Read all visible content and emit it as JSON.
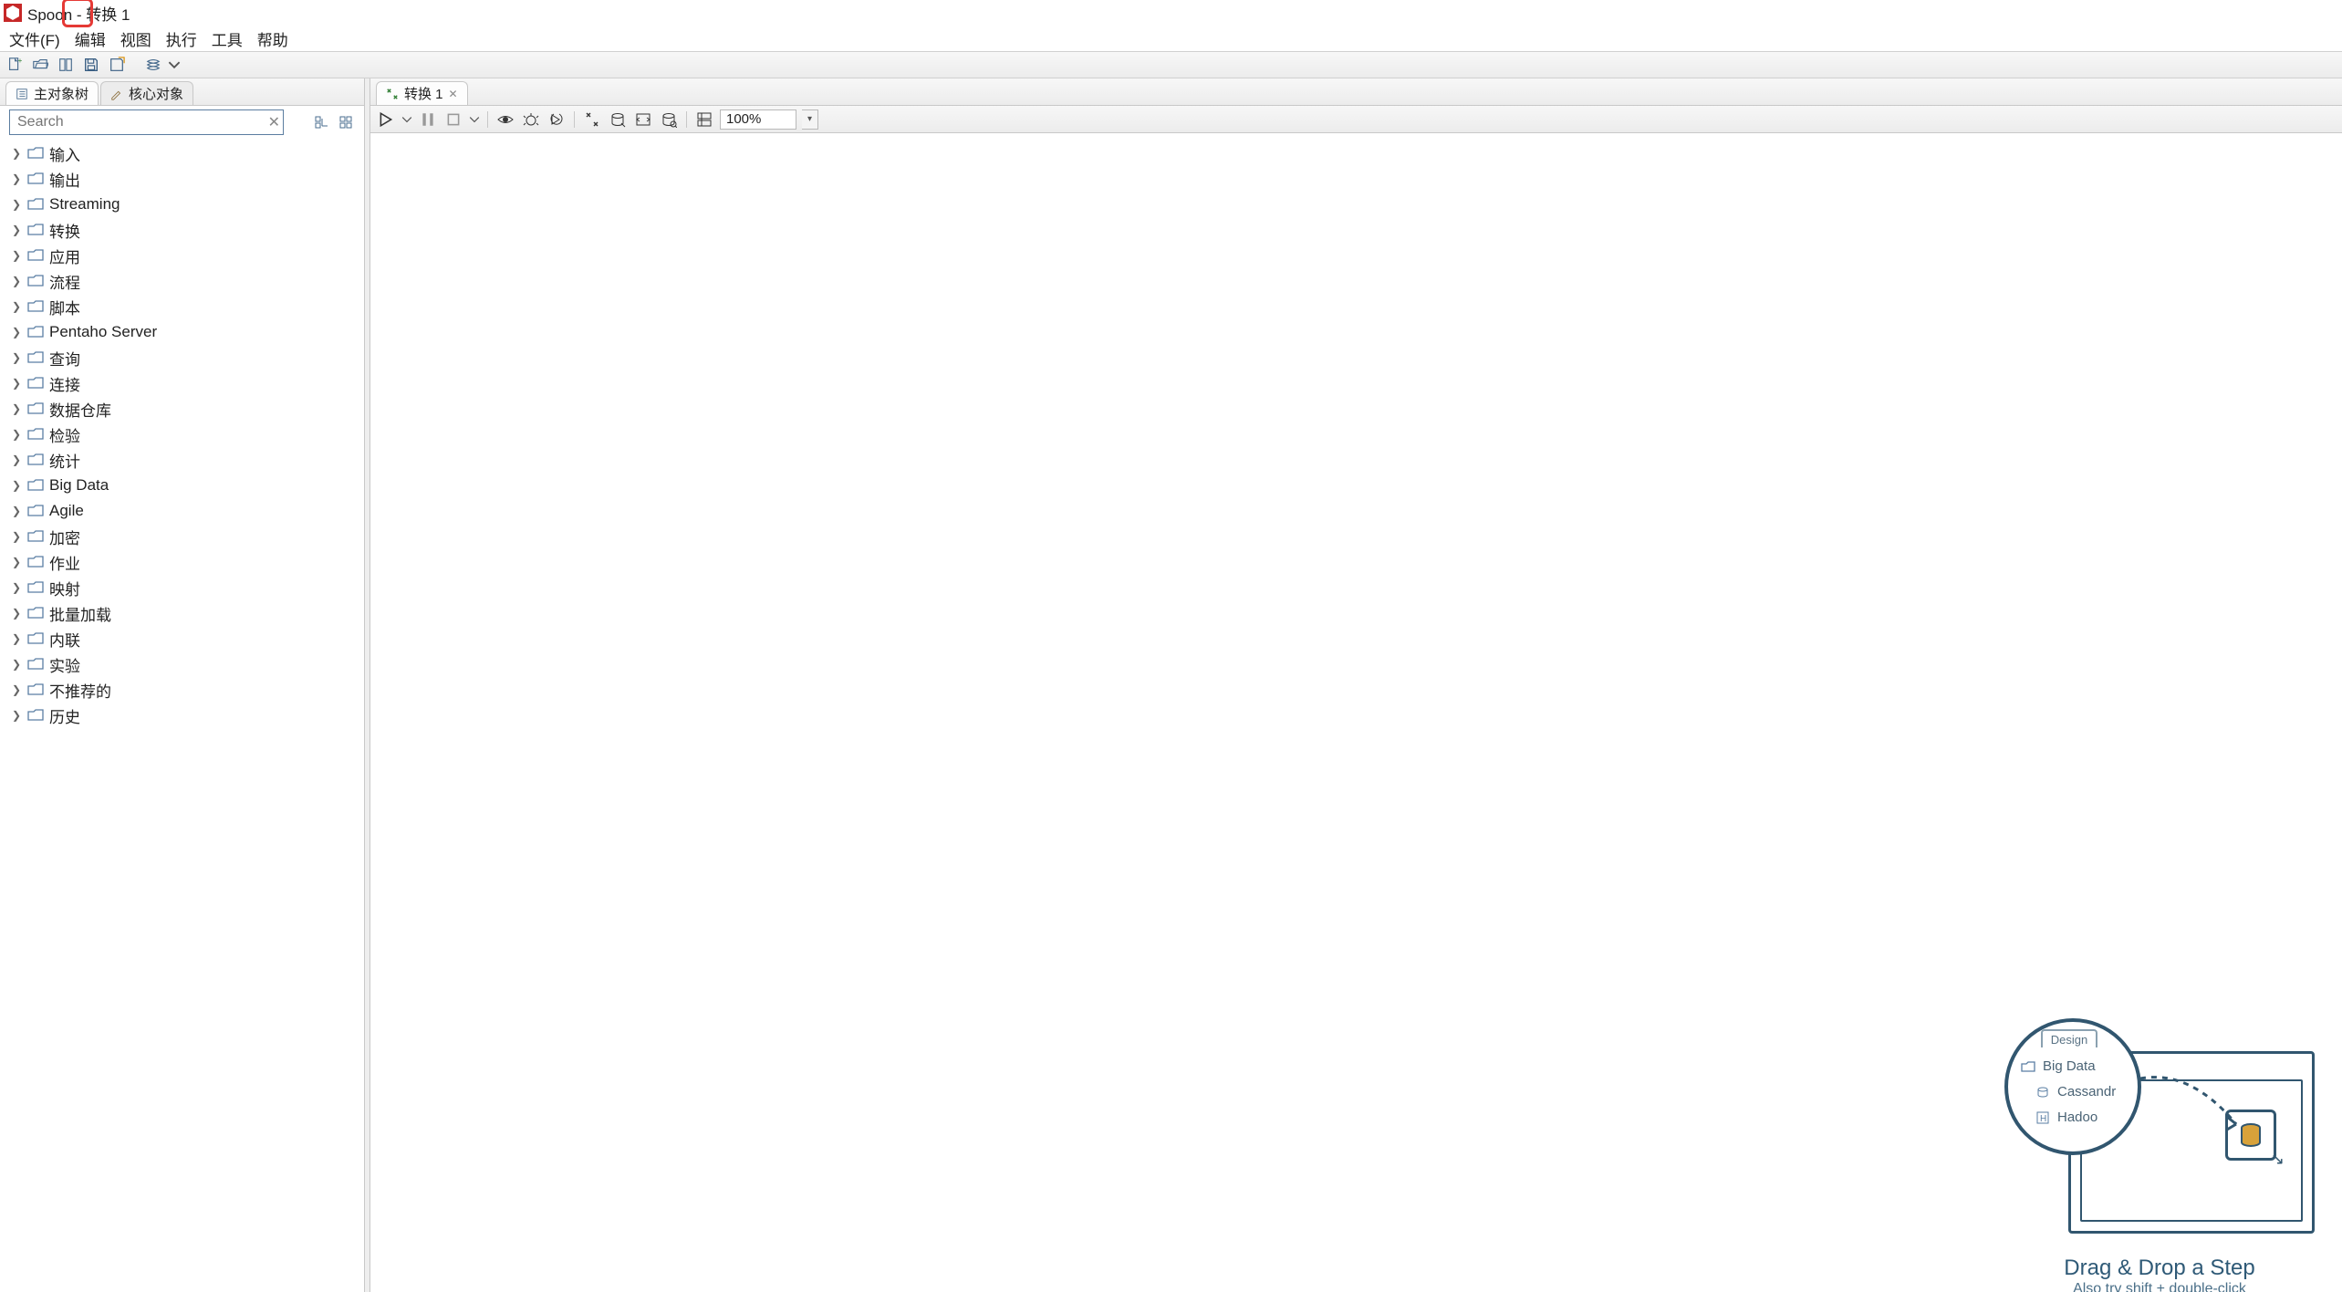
{
  "window": {
    "title": "Spoon - 转换 1"
  },
  "menu": {
    "items": [
      "文件(F)",
      "编辑",
      "视图",
      "执行",
      "工具",
      "帮助"
    ]
  },
  "toolbar": {
    "items": [
      "new-file",
      "open-file",
      "explore-repo",
      "save",
      "save-as",
      "layers",
      "layers-dropdown"
    ]
  },
  "left": {
    "tabs": [
      {
        "id": "main-tree",
        "label": "主对象树",
        "icon": "tree-icon"
      },
      {
        "id": "core-objects",
        "label": "核心对象",
        "icon": "pencil-icon"
      }
    ],
    "search_placeholder": "Search",
    "tree": [
      "输入",
      "输出",
      "Streaming",
      "转换",
      "应用",
      "流程",
      "脚本",
      "Pentaho Server",
      "查询",
      "连接",
      "数据仓库",
      "检验",
      "统计",
      "Big Data",
      "Agile",
      "加密",
      "作业",
      "映射",
      "批量加载",
      "内联",
      "实验",
      "不推荐的",
      "历史"
    ]
  },
  "editor": {
    "tab_label": "转换 1",
    "zoom": "100%",
    "hint": {
      "design_tab": "Design",
      "rows": [
        "Big Data",
        "Cassandr",
        "Hadoo"
      ],
      "title": "Drag & Drop a Step",
      "subtitle": "Also try shift + double-click"
    }
  }
}
